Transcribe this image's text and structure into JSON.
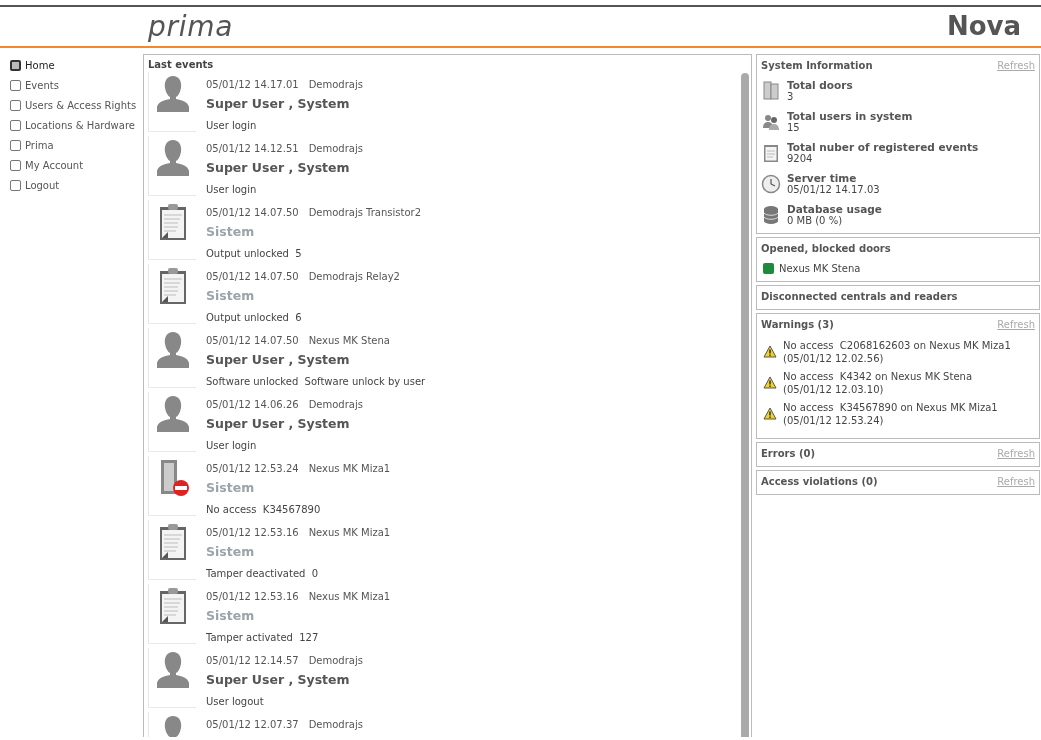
{
  "header": {
    "logo": "prima",
    "product": "Nova"
  },
  "sidebar": {
    "items": [
      {
        "label": "Home",
        "selected": true
      },
      {
        "label": "Events",
        "selected": false
      },
      {
        "label": "Users & Access Rights",
        "selected": false
      },
      {
        "label": "Locations & Hardware",
        "selected": false
      },
      {
        "label": "Prima",
        "selected": false
      },
      {
        "label": "My Account",
        "selected": false
      },
      {
        "label": "Logout",
        "selected": false
      }
    ]
  },
  "events": {
    "title": "Last events",
    "items": [
      {
        "kind": "user",
        "time": "05/01/12 14.17.01",
        "source": "Demodrajs",
        "actor": "Super User , System",
        "description": "User login"
      },
      {
        "kind": "user",
        "time": "05/01/12 14.12.51",
        "source": "Demodrajs",
        "actor": "Super User , System",
        "description": "User login"
      },
      {
        "kind": "event",
        "time": "05/01/12 14.07.50",
        "source": "Demodrajs Transistor2",
        "actor": "Sistem",
        "description": "Output unlocked  5"
      },
      {
        "kind": "event",
        "time": "05/01/12 14.07.50",
        "source": "Demodrajs Relay2",
        "actor": "Sistem",
        "description": "Output unlocked  6"
      },
      {
        "kind": "user",
        "time": "05/01/12 14.07.50",
        "source": "Nexus MK Stena",
        "actor": "Super User , System",
        "description": "Software unlocked  Software unlock by user"
      },
      {
        "kind": "user",
        "time": "05/01/12 14.06.26",
        "source": "Demodrajs",
        "actor": "Super User , System",
        "description": "User login"
      },
      {
        "kind": "denied",
        "time": "05/01/12 12.53.24",
        "source": "Nexus MK Miza1",
        "actor": "Sistem",
        "description": "No access  K34567890"
      },
      {
        "kind": "event",
        "time": "05/01/12 12.53.16",
        "source": "Nexus MK Miza1",
        "actor": "Sistem",
        "description": "Tamper deactivated  0"
      },
      {
        "kind": "event",
        "time": "05/01/12 12.53.16",
        "source": "Nexus MK Miza1",
        "actor": "Sistem",
        "description": "Tamper activated  127"
      },
      {
        "kind": "user",
        "time": "05/01/12 12.14.57",
        "source": "Demodrajs",
        "actor": "Super User , System",
        "description": "User logout"
      },
      {
        "kind": "user",
        "time": "05/01/12 12.07.37",
        "source": "Demodrajs"
      }
    ]
  },
  "system_information": {
    "title": "System Information",
    "refresh": "Refresh",
    "items": [
      {
        "kind": "doors",
        "label": "Total doors",
        "value": "3"
      },
      {
        "kind": "users",
        "label": "Total users in system",
        "value": "15"
      },
      {
        "kind": "events",
        "label": "Total nuber of registered events",
        "value": "9204"
      },
      {
        "kind": "clock",
        "label": "Server time",
        "value": "05/01/12 14.17.03"
      },
      {
        "kind": "database",
        "label": "Database usage",
        "value": "0 MB (0 %)"
      }
    ]
  },
  "opened_blocked_doors": {
    "title": "Opened, blocked doors",
    "items": [
      {
        "label": "Nexus MK Stena",
        "color": "#1e8a3c"
      }
    ]
  },
  "disconnected": {
    "title": "Disconnected centrals and readers"
  },
  "warnings": {
    "title": "Warnings (3)",
    "refresh": "Refresh",
    "items": [
      {
        "line1": "No access  C2068162603 on Nexus MK Miza1",
        "line2": "(05/01/12 12.02.56)"
      },
      {
        "line1": "No access  K4342 on Nexus MK Stena",
        "line2": "(05/01/12 12.03.10)"
      },
      {
        "line1": "No access  K34567890 on Nexus MK Miza1",
        "line2": "(05/01/12 12.53.24)"
      }
    ]
  },
  "errors": {
    "title": "Errors (0)",
    "refresh": "Refresh"
  },
  "access_violations": {
    "title": "Access violations (0)",
    "refresh": "Refresh"
  }
}
